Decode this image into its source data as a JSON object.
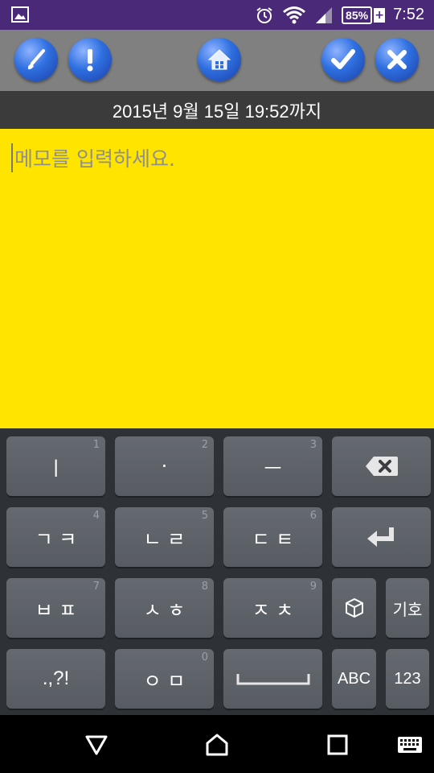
{
  "status_bar": {
    "battery": "85%",
    "battery_plus": "+",
    "time": "7:52"
  },
  "toolbar": {
    "left_buttons": [
      "brush-icon",
      "alert-icon"
    ],
    "center_button": "home-icon",
    "right_buttons": [
      "check-icon",
      "close-icon"
    ]
  },
  "date_bar": {
    "text": "2015년 9월 15일 19:52까지"
  },
  "memo": {
    "placeholder": "메모를 입력하세요."
  },
  "keyboard": {
    "row1": [
      {
        "label": "ㅣ",
        "num": "1"
      },
      {
        "label": "·",
        "num": "2"
      },
      {
        "label": "ㅡ",
        "num": "3"
      }
    ],
    "row2": [
      {
        "label": "ㄱ ㅋ",
        "num": "4"
      },
      {
        "label": "ㄴ ㄹ",
        "num": "5"
      },
      {
        "label": "ㄷ ㅌ",
        "num": "6"
      }
    ],
    "row3": [
      {
        "label": "ㅂ ㅍ",
        "num": "7"
      },
      {
        "label": "ㅅ ㅎ",
        "num": "8"
      },
      {
        "label": "ㅈ ㅊ",
        "num": "9"
      }
    ],
    "row4": [
      {
        "label": ".,?!",
        "num": ""
      },
      {
        "label": "ㅇ ㅁ",
        "num": "0"
      }
    ],
    "symbols": "기호",
    "abc": "ABC",
    "numbers": "123"
  },
  "colors": {
    "status_bar": "#4a2a78",
    "toolbar": "#808080",
    "date_bar": "#3b3b3b",
    "memo_bg": "#ffe400",
    "keyboard_bg": "#2e3236",
    "key": "#5e6369"
  }
}
